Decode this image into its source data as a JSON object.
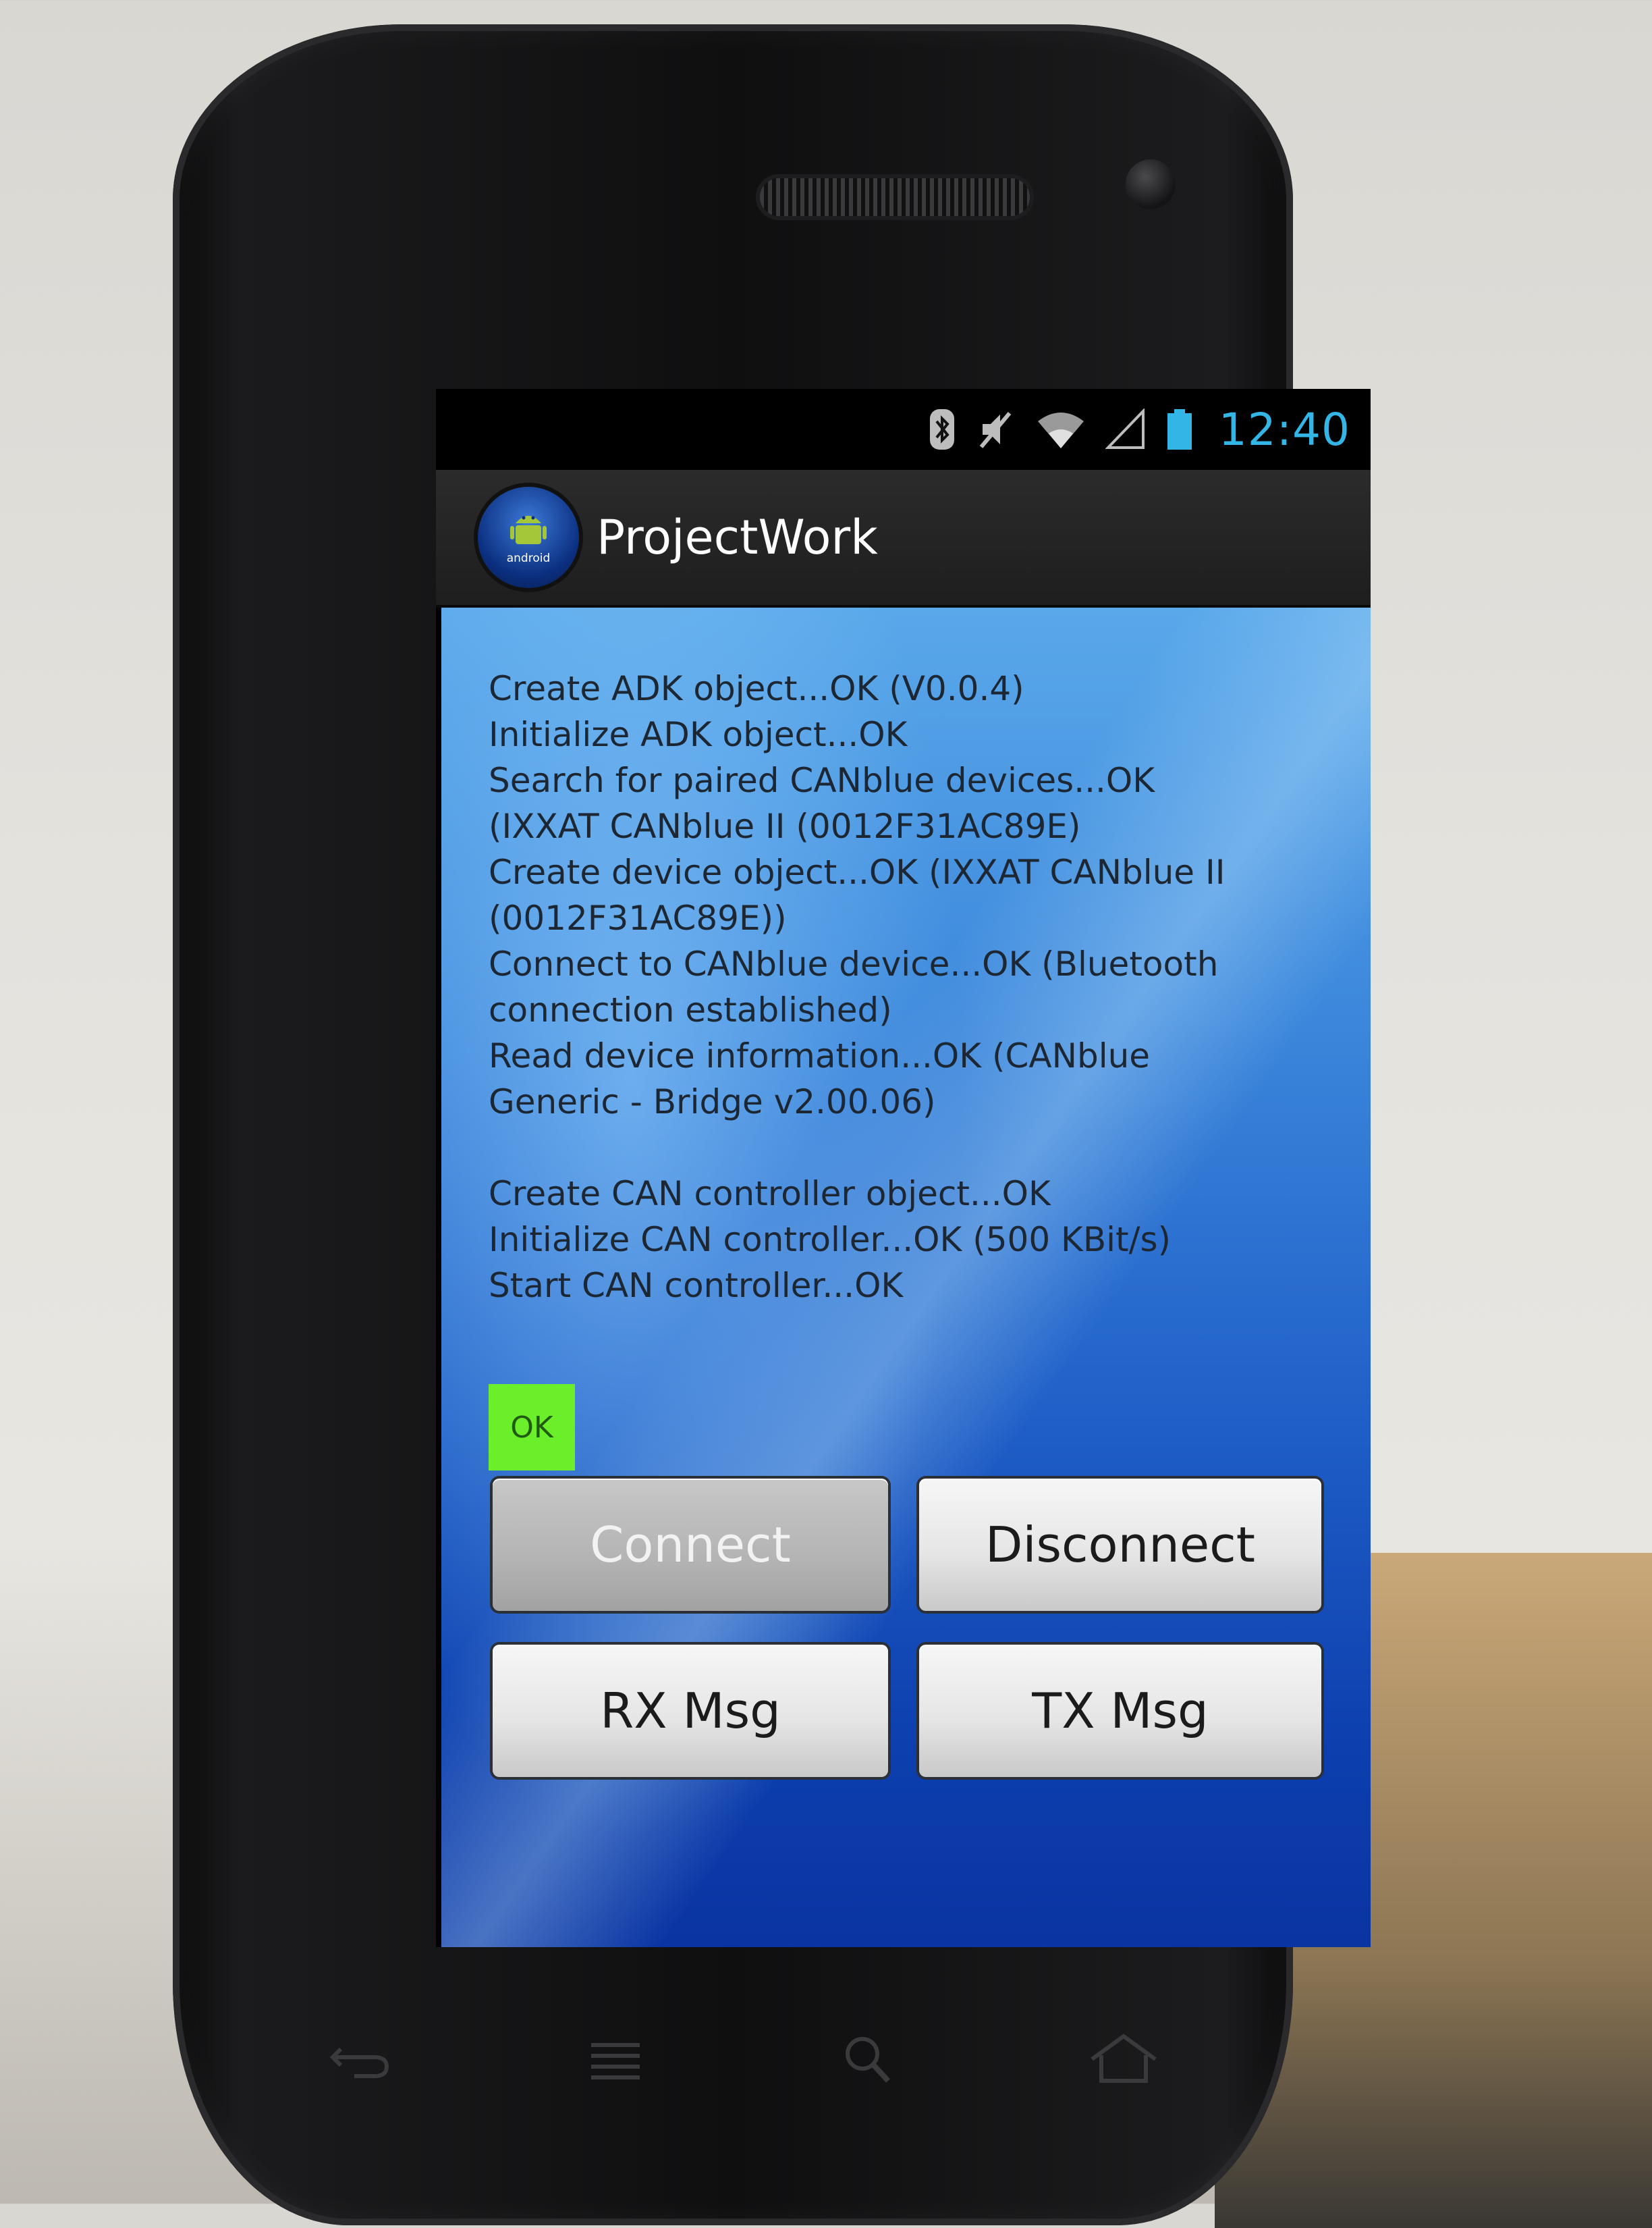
{
  "status_bar": {
    "time": "12:40",
    "icons": [
      "bluetooth-icon",
      "mute-icon",
      "wifi-icon",
      "signal-icon",
      "battery-icon"
    ],
    "accent_color": "#33b5e5"
  },
  "action_bar": {
    "title": "ProjectWork",
    "icon_text": "android"
  },
  "log": {
    "lines": [
      "Create ADK object...OK (V0.0.4)",
      "Initialize ADK object...OK",
      "Search for paired CANblue devices...OK",
      "(IXXAT CANblue II (0012F31AC89E)",
      "Create device object...OK (IXXAT CANblue II",
      "(0012F31AC89E))",
      "Connect to CANblue device...OK (Bluetooth",
      "connection established)",
      "Read device information...OK (CANblue",
      "Generic - Bridge v2.00.06)",
      "",
      "Create CAN controller object...OK",
      "Initialize CAN controller...OK (500 KBit/s)",
      "Start CAN controller...OK"
    ]
  },
  "status_indicator": {
    "label": "OK",
    "color": "#6aef2a"
  },
  "buttons": {
    "connect": "Connect",
    "disconnect": "Disconnect",
    "rx_msg": "RX Msg",
    "tx_msg": "TX Msg"
  },
  "nav_keys": [
    "back-icon",
    "menu-icon",
    "search-icon",
    "home-icon"
  ]
}
